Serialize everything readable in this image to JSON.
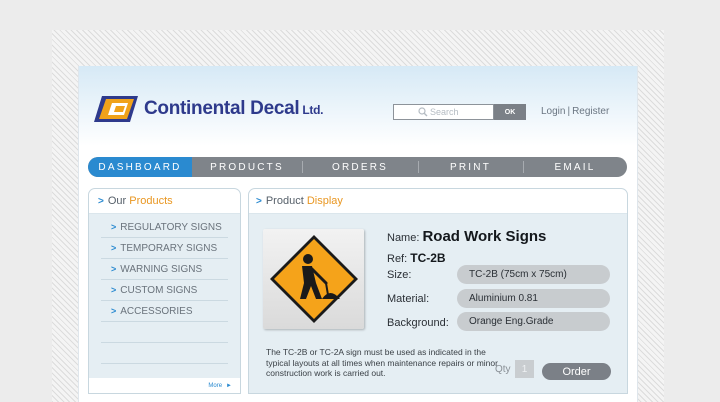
{
  "header": {
    "brand_name": "Continental Decal",
    "brand_suffix": "Ltd.",
    "search": {
      "placeholder": "Search",
      "button_label": "OK"
    },
    "auth": {
      "login": "Login",
      "separator": "|",
      "register": "Register"
    }
  },
  "nav": {
    "items": [
      {
        "label": "DASHBOARD",
        "active": true
      },
      {
        "label": "PRODUCTS",
        "active": false
      },
      {
        "label": "ORDERS",
        "active": false
      },
      {
        "label": "PRINT",
        "active": false
      },
      {
        "label": "EMAIL",
        "active": false
      }
    ]
  },
  "sidebar": {
    "title_prefix": "Our",
    "title_accent": "Products",
    "items": [
      {
        "label": "REGULATORY SIGNS"
      },
      {
        "label": "TEMPORARY SIGNS"
      },
      {
        "label": "WARNING SIGNS"
      },
      {
        "label": "CUSTOM SIGNS"
      },
      {
        "label": "ACCESSORIES"
      }
    ],
    "more_label": "More"
  },
  "product": {
    "title_prefix": "Product",
    "title_accent": "Display",
    "name_label": "Name:",
    "name": "Road Work Signs",
    "ref_label": "Ref:",
    "ref": "TC-2B",
    "size_label": "Size:",
    "size": "TC-2B (75cm x 75cm)",
    "material_label": "Material:",
    "material": "Aluminium 0.81",
    "background_label": "Background:",
    "background": "Orange Eng.Grade",
    "description": "The TC-2B or TC-2A sign must be used as indicated in the typical layouts at all times when maintenance repairs or minor construction work is carried out.",
    "qty_label": "Qty",
    "qty_value": "1",
    "order_label": "Order"
  },
  "colors": {
    "brand_blue": "#2e3a8c",
    "accent_orange": "#e99722",
    "nav_active": "#2a8ad0",
    "nav_bg": "#7f848a",
    "sign_orange": "#f5a31a"
  },
  "icons": {
    "logo": "continental-decal-logo",
    "search": "search-icon",
    "chevron": "chevron-right-icon",
    "sign": "road-work-sign-icon"
  }
}
